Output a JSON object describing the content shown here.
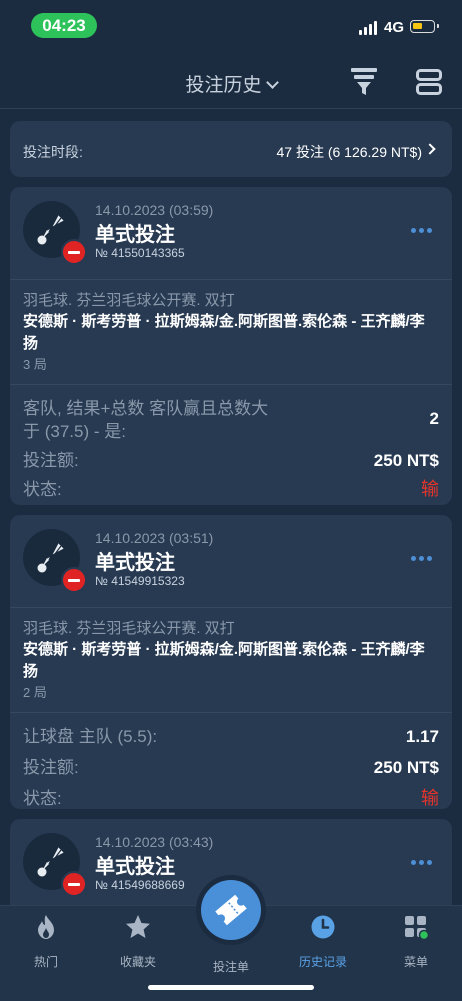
{
  "status": {
    "time": "04:23",
    "network": "4G"
  },
  "header": {
    "title": "投注历史"
  },
  "period": {
    "label": "投注时段:",
    "summary": "47 投注 (6 126.29 NT$)"
  },
  "bets": [
    {
      "date": "14.10.2023 (03:59)",
      "type": "单式投注",
      "number": "№ 41550143365",
      "league": "羽毛球. 芬兰羽毛球公开赛. 双打",
      "teams": "安德斯 · 斯考劳普 · 拉斯姆森/金.阿斯图普.索伦森 - 王齐麟/李扬",
      "set": "3 局",
      "market": "客队, 结果+总数 客队赢且总数大于 (37.5) - 是:",
      "odds": "2",
      "stake_label": "投注额:",
      "stake": "250 NT$",
      "status_label": "状态:",
      "status": "输"
    },
    {
      "date": "14.10.2023 (03:51)",
      "type": "单式投注",
      "number": "№ 41549915323",
      "league": "羽毛球. 芬兰羽毛球公开赛. 双打",
      "teams": "安德斯 · 斯考劳普 · 拉斯姆森/金.阿斯图普.索伦森 - 王齐麟/李扬",
      "set": "2 局",
      "market": "让球盘 主队 (5.5):",
      "odds": "1.17",
      "stake_label": "投注额:",
      "stake": "250 NT$",
      "status_label": "状态:",
      "status": "输"
    },
    {
      "date": "14.10.2023 (03:43)",
      "type": "单式投注",
      "number": "№ 41549688669"
    }
  ],
  "tabs": [
    {
      "label": "热门",
      "icon": "flame-icon"
    },
    {
      "label": "收藏夹",
      "icon": "star-icon"
    },
    {
      "label": "投注单",
      "icon": "ticket-icon"
    },
    {
      "label": "历史记录",
      "icon": "clock-icon"
    },
    {
      "label": "菜单",
      "icon": "menu-grid-icon"
    }
  ],
  "colors": {
    "loss": "#e5352b",
    "accent": "#4a90d9",
    "background": "#1c2c40"
  }
}
